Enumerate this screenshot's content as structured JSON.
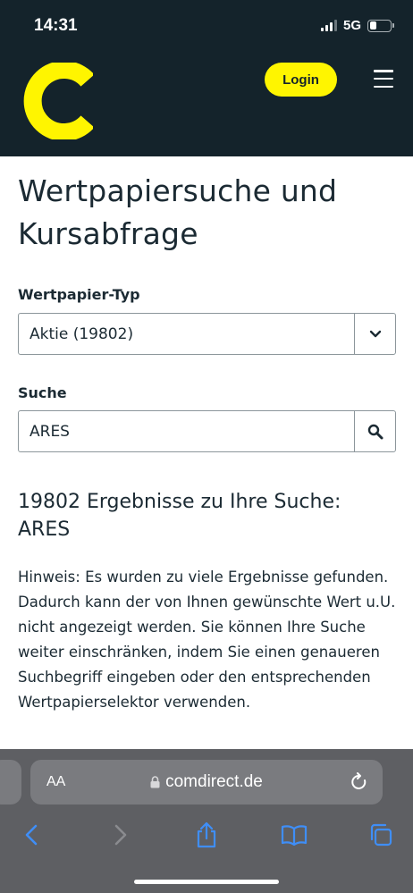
{
  "status_bar": {
    "time": "14:31",
    "network": "5G",
    "battery_level": 0.35
  },
  "header": {
    "login_label": "Login",
    "logo_icon": "comdirect-c-logo",
    "menu_icon": "hamburger-menu-icon",
    "brand_color": "#fff500",
    "background_color": "#14232b"
  },
  "main": {
    "title": "Wertpapiersuche und Kursabfrage",
    "type_label": "Wertpapier-Typ",
    "type_value": "Aktie (19802)",
    "search_label": "Suche",
    "search_value": "ARES",
    "results_title": "19802 Ergebnisse zu Ihre Suche: ARES",
    "hint": "Hinweis: Es wurden zu viele Ergebnisse gefunden. Dadurch kann der von Ihnen gewünschte Wert u.U. nicht angezeigt werden. Sie können Ihre Suche weiter einschränken, indem Sie einen genaueren Suchbegriff eingeben oder den entsprechenden Wertpapierselektor verwenden."
  },
  "browser": {
    "aa_label": "AA",
    "url": "comdirect.de"
  }
}
